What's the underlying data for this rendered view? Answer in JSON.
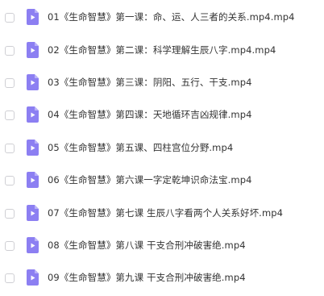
{
  "colors": {
    "icon_fill": "#8c7ff2",
    "icon_fold": "#b9b1f8",
    "icon_glyph": "#ffffff",
    "text": "#333333",
    "checkbox_border": "#cfcfd4"
  },
  "files": [
    {
      "name": "01《生命智慧》第一课：命、运、人三者的关系.mp4.mp4",
      "icon": "video-file-icon"
    },
    {
      "name": "02《生命智慧》第二课：科学理解生辰八字.mp4.mp4",
      "icon": "video-file-icon"
    },
    {
      "name": "03《生命智慧》第三课：阴阳、五行、干支.mp4",
      "icon": "video-file-icon"
    },
    {
      "name": "04《生命智慧》第四课：天地循环吉凶规律.mp4",
      "icon": "video-file-icon"
    },
    {
      "name": "05《生命智慧》第五课、四柱宫位分野.mp4",
      "icon": "video-file-icon"
    },
    {
      "name": "06《生命智慧》第六课一字定乾坤识命法宝.mp4",
      "icon": "video-file-icon"
    },
    {
      "name": "07《生命智慧》第七课 生辰八字看两个人关系好坏.mp4",
      "icon": "video-file-icon"
    },
    {
      "name": "08《生命智慧》第八课 干支合刑冲破害绝.mp4",
      "icon": "video-file-icon"
    },
    {
      "name": "09《生命智慧》第九课 干支合刑冲破害绝.mp4",
      "icon": "video-file-icon"
    }
  ]
}
